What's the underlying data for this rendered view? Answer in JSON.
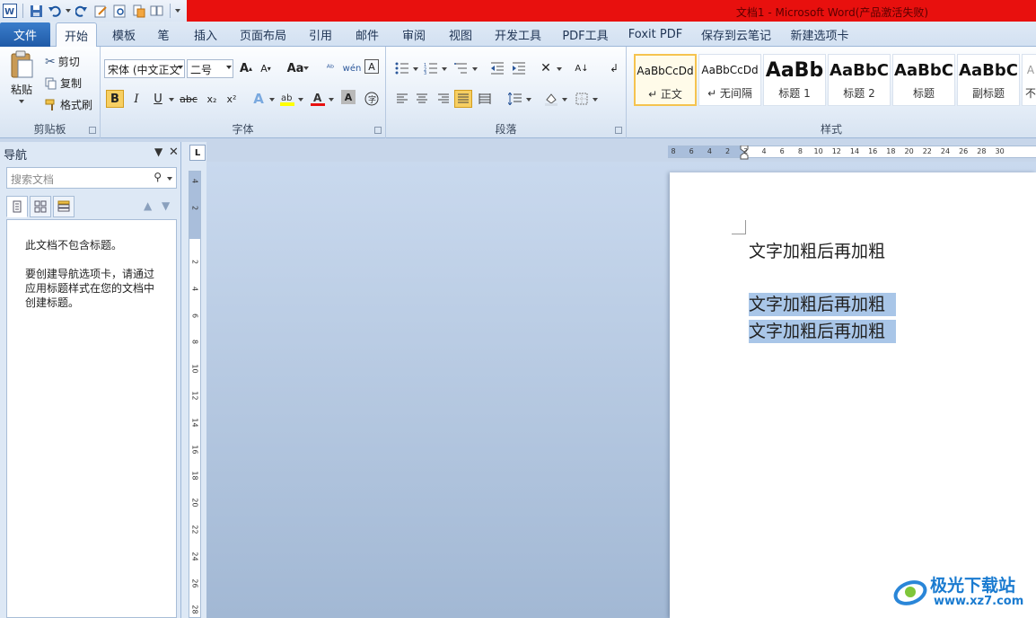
{
  "app": {
    "title": "文档1 - Microsoft Word(产品激活失败)"
  },
  "tabs": {
    "file": "文件",
    "items": [
      "开始",
      "模板",
      "笔",
      "插入",
      "页面布局",
      "引用",
      "邮件",
      "审阅",
      "视图",
      "开发工具",
      "PDF工具",
      "Foxit PDF",
      "保存到云笔记",
      "新建选项卡"
    ],
    "active": "开始"
  },
  "ribbon": {
    "clipboard": {
      "paste": "粘贴",
      "cut": "剪切",
      "copy": "复制",
      "format_painter": "格式刷",
      "label": "剪贴板"
    },
    "font": {
      "font_name": "宋体 (中文正文",
      "font_size": "二号",
      "change_case": "Aa",
      "bold": "B",
      "italic": "I",
      "underline": "U",
      "strike": "abc",
      "sub": "x₂",
      "sup": "x²",
      "grow": "A",
      "shrink": "A",
      "label": "字体"
    },
    "paragraph": {
      "label": "段落"
    },
    "styles": {
      "label": "样式",
      "items": [
        {
          "sample": "AaBbCcDd",
          "name": "↵ 正文"
        },
        {
          "sample": "AaBbCcDd",
          "name": "↵ 无间隔"
        },
        {
          "sample": "AaBb",
          "name": "标题 1"
        },
        {
          "sample": "AaBbC",
          "name": "标题 2"
        },
        {
          "sample": "AaBbC",
          "name": "标题"
        },
        {
          "sample": "AaBbC",
          "name": "副标题"
        },
        {
          "sample": "A",
          "name": "不"
        }
      ]
    }
  },
  "nav": {
    "title": "导航",
    "search_placeholder": "搜索文档",
    "message1": "此文档不包含标题。",
    "message2": "要创建导航选项卡，请通过应用标题样式在您的文档中创建标题。"
  },
  "ruler": {
    "h_ticks": [
      "8",
      "6",
      "4",
      "2",
      "2",
      "4",
      "6",
      "8",
      "10",
      "12",
      "14",
      "16",
      "18",
      "20",
      "22",
      "24",
      "26",
      "28",
      "30"
    ],
    "v_ticks": [
      "4",
      "2",
      "2",
      "4",
      "6",
      "8",
      "10",
      "12",
      "14",
      "16",
      "18",
      "20",
      "22",
      "24",
      "26",
      "28"
    ],
    "tab_stop": "L"
  },
  "document": {
    "line1": "文字加粗后再加粗",
    "line2": "文字加粗后再加粗",
    "line3": "文字加粗后再加粗"
  },
  "watermark": {
    "name": "极光下载站",
    "url": "www.xz7.com"
  },
  "colors": {
    "title_red": "#e8100e",
    "file_tab": "#2a6bbd",
    "selection": "#a9c6e8"
  }
}
